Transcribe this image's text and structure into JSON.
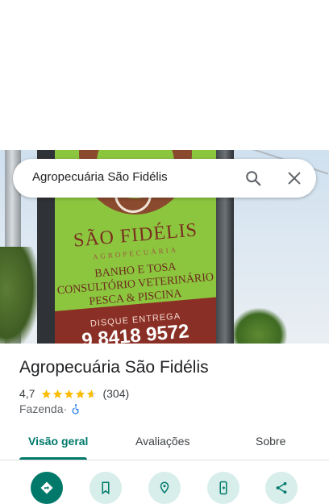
{
  "search": {
    "query": "Agropecuária São Fidélis"
  },
  "hero": {
    "sign_brand": "SÃO FIDÉLIS",
    "sign_sub": "AGROPECUÁRIA",
    "sign_line1": "BANHO E TOSA",
    "sign_line2": "CONSULTÓRIO VETERINÁRIO",
    "sign_line3": "PESCA & PISCINA",
    "sign_disque": "DISQUE ENTREGA",
    "sign_phone": "9 8418 9572"
  },
  "place": {
    "name": "Agropecuária São Fidélis",
    "rating": "4,7",
    "stars": 4.7,
    "reviews": "(304)",
    "category": "Fazenda",
    "separator": " · "
  },
  "tabs": [
    {
      "label": "Visão geral",
      "active": true
    },
    {
      "label": "Avaliações",
      "active": false
    },
    {
      "label": "Sobre",
      "active": false
    }
  ],
  "actions": [
    {
      "icon": "directions-icon"
    },
    {
      "icon": "bookmark-icon"
    },
    {
      "icon": "nearby-icon"
    },
    {
      "icon": "send-to-phone-icon"
    },
    {
      "icon": "share-icon"
    }
  ],
  "colors": {
    "accent": "#00796b",
    "star": "#fbbc04",
    "chip_bg": "#d7eeeb"
  }
}
